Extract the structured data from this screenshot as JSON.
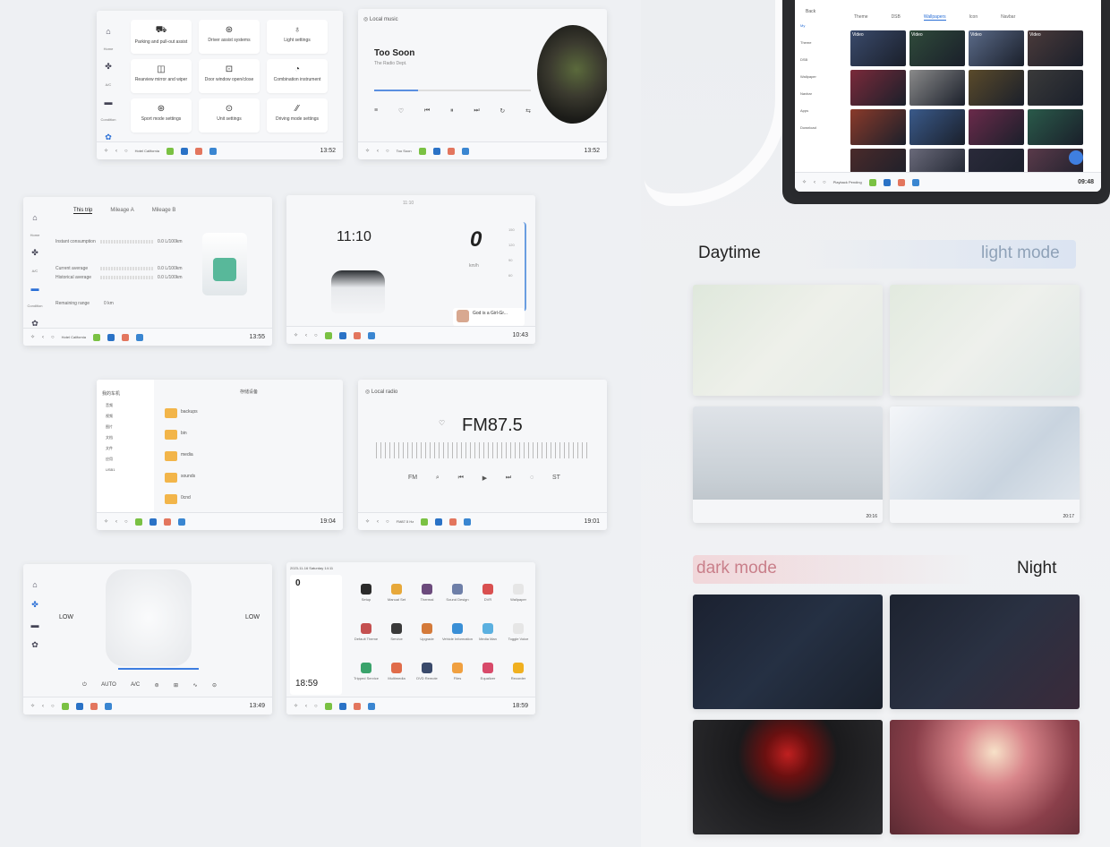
{
  "settings_screen": {
    "sidebar": [
      "Home",
      "A/C",
      "Condition",
      "Settings"
    ],
    "tiles": [
      "Parking and pull-out assist",
      "Driver assist systems",
      "Light settings",
      "Rearview mirror and wiper",
      "Door window open/close",
      "Combination instrument",
      "Sport mode settings",
      "Unit settings",
      "Driving mode settings"
    ],
    "dock_song": "Hotel California",
    "time": "13:52"
  },
  "music_screen": {
    "source": "Local music",
    "title": "Too Soon",
    "artist": "The Radio Dept.",
    "dock_song": "Too Soon",
    "time": "13:52"
  },
  "trip_screen": {
    "tabs": [
      "This trip",
      "Mileage A",
      "Mileage B"
    ],
    "rows": [
      {
        "label": "Instant consumption",
        "value": "0.0 L/100km"
      },
      {
        "label": "Current average",
        "value": "0.0 L/100km"
      },
      {
        "label": "Historical average",
        "value": "0.0 L/100km"
      },
      {
        "label": "Remaining range",
        "value": "0 km"
      }
    ],
    "sidebar": [
      "Home",
      "A/C",
      "Condition",
      "Settings"
    ],
    "dock_song": "Hotel California",
    "time": "13:55"
  },
  "cluster_screen": {
    "clock": "11:10",
    "speed": "0",
    "unit": "km/h",
    "scale": [
      "150",
      "120",
      "90",
      "60",
      "30",
      "0"
    ],
    "song": "God is a Girl-Gr...",
    "time": "10:43",
    "header_time": "11:10"
  },
  "files_screen": {
    "title": "存储设备",
    "sidebar_title": "我的车机",
    "left_items": [
      "音频",
      "视频",
      "图片",
      "文档",
      "文件",
      "应用",
      "USB1"
    ],
    "folders": [
      "backups",
      "bin",
      "media",
      "sounds",
      "0cnd"
    ],
    "time": "19:04"
  },
  "radio_screen": {
    "source": "Local radio",
    "freq": "FM87.5",
    "dock_song": "FM87.5 Hz",
    "time": "19:01"
  },
  "climate_screen": {
    "left_level": "LOW",
    "right_level": "LOW",
    "buttons": [
      "AUTO",
      "A/C"
    ],
    "time": "13:49"
  },
  "apps_screen": {
    "date": "2023-11-16 Saturday 14:11",
    "speed": "0",
    "time_big": "18:59",
    "apps": [
      "Setup",
      "Manual Set",
      "Thermal",
      "Sound Design",
      "DVR",
      "Wallpaper",
      "Default Theme",
      "Service",
      "Upgrade",
      "Vehicle Information",
      "Media Man",
      "Toggle Voice",
      "Tripped Service",
      "Multimedia",
      "DVD Remote",
      "Files",
      "Equalizer",
      "Recorder"
    ],
    "time": "18:59"
  },
  "tablet": {
    "back": "Back",
    "tabs": [
      "Theme",
      "DSB",
      "Wallpapers",
      "Icon",
      "Navbar"
    ],
    "menu": [
      "My",
      "Theme",
      "DSB",
      "Wallpaper",
      "Navbar",
      "Apps",
      "Download"
    ],
    "song": "Playback Pending",
    "time": "09:48",
    "badges": [
      "Video",
      "Video",
      "Video",
      "Video"
    ]
  },
  "labels": {
    "daytime": "Daytime",
    "light_mode": "light mode",
    "dark_mode": "dark mode",
    "night": "Night"
  },
  "mini_times": [
    "20:16",
    "20:17"
  ]
}
